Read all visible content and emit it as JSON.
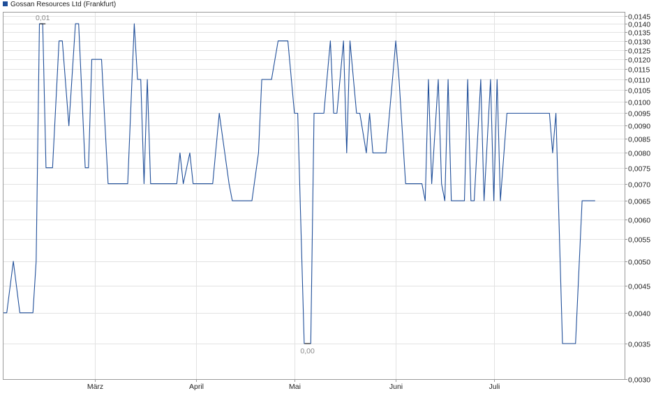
{
  "chart_data": {
    "type": "line",
    "title": "",
    "legend": {
      "label": "Gossan Resources Ltd (Frankfurt)",
      "color": "#1f4e99",
      "placement": "top-left"
    },
    "y_scale": "log",
    "ylim": [
      0.003,
      0.0147
    ],
    "y_ticks": [
      {
        "v": 0.003,
        "label": "0,0030"
      },
      {
        "v": 0.0035,
        "label": "0,0035"
      },
      {
        "v": 0.004,
        "label": "0,0040"
      },
      {
        "v": 0.0045,
        "label": "0,0045"
      },
      {
        "v": 0.005,
        "label": "0,0050"
      },
      {
        "v": 0.0055,
        "label": "0,0055"
      },
      {
        "v": 0.006,
        "label": "0,0060"
      },
      {
        "v": 0.0065,
        "label": "0,0065"
      },
      {
        "v": 0.007,
        "label": "0,0070"
      },
      {
        "v": 0.0075,
        "label": "0,0075"
      },
      {
        "v": 0.008,
        "label": "0,0080"
      },
      {
        "v": 0.0085,
        "label": "0,0085"
      },
      {
        "v": 0.009,
        "label": "0,0090"
      },
      {
        "v": 0.0095,
        "label": "0,0095"
      },
      {
        "v": 0.01,
        "label": "0,0100"
      },
      {
        "v": 0.0105,
        "label": "0,0105"
      },
      {
        "v": 0.011,
        "label": "0,0110"
      },
      {
        "v": 0.0115,
        "label": "0,0115"
      },
      {
        "v": 0.012,
        "label": "0,0120"
      },
      {
        "v": 0.0125,
        "label": "0,0125"
      },
      {
        "v": 0.013,
        "label": "0,0130"
      },
      {
        "v": 0.0135,
        "label": "0,0135"
      },
      {
        "v": 0.014,
        "label": "0,0140"
      },
      {
        "v": 0.0145,
        "label": "0,0145"
      }
    ],
    "x_range": [
      "2013-02-01",
      "2013-08-10"
    ],
    "x_ticks": [
      {
        "date": "2013-03-01",
        "label": "März"
      },
      {
        "date": "2013-04-01",
        "label": "April"
      },
      {
        "date": "2013-05-01",
        "label": "Mai"
      },
      {
        "date": "2013-06-01",
        "label": "Juni"
      },
      {
        "date": "2013-07-01",
        "label": "Juli"
      }
    ],
    "grid": true,
    "series": [
      {
        "name": "Gossan Resources Ltd (Frankfurt)",
        "color": "#1f4e99",
        "points": [
          [
            "2013-02-01",
            0.004
          ],
          [
            "2013-02-02",
            0.004
          ],
          [
            "2013-02-04",
            0.005
          ],
          [
            "2013-02-06",
            0.004
          ],
          [
            "2013-02-10",
            0.004
          ],
          [
            "2013-02-11",
            0.005
          ],
          [
            "2013-02-12",
            0.014
          ],
          [
            "2013-02-13",
            0.014
          ],
          [
            "2013-02-14",
            0.0075
          ],
          [
            "2013-02-16",
            0.0075
          ],
          [
            "2013-02-18",
            0.013
          ],
          [
            "2013-02-19",
            0.013
          ],
          [
            "2013-02-21",
            0.009
          ],
          [
            "2013-02-23",
            0.014
          ],
          [
            "2013-02-24",
            0.014
          ],
          [
            "2013-02-26",
            0.0075
          ],
          [
            "2013-02-27",
            0.0075
          ],
          [
            "2013-02-28",
            0.012
          ],
          [
            "2013-03-01",
            0.012
          ],
          [
            "2013-03-02",
            0.012
          ],
          [
            "2013-03-03",
            0.012
          ],
          [
            "2013-03-05",
            0.007
          ],
          [
            "2013-03-11",
            0.007
          ],
          [
            "2013-03-13",
            0.014
          ],
          [
            "2013-03-14",
            0.011
          ],
          [
            "2013-03-15",
            0.011
          ],
          [
            "2013-03-16",
            0.007
          ],
          [
            "2013-03-17",
            0.011
          ],
          [
            "2013-03-18",
            0.007
          ],
          [
            "2013-03-26",
            0.007
          ],
          [
            "2013-03-27",
            0.008
          ],
          [
            "2013-03-28",
            0.007
          ],
          [
            "2013-03-30",
            0.008
          ],
          [
            "2013-03-31",
            0.007
          ],
          [
            "2013-04-06",
            0.007
          ],
          [
            "2013-04-08",
            0.0095
          ],
          [
            "2013-04-11",
            0.007
          ],
          [
            "2013-04-12",
            0.0065
          ],
          [
            "2013-04-18",
            0.0065
          ],
          [
            "2013-04-20",
            0.008
          ],
          [
            "2013-04-21",
            0.011
          ],
          [
            "2013-04-24",
            0.011
          ],
          [
            "2013-04-26",
            0.013
          ],
          [
            "2013-04-29",
            0.013
          ],
          [
            "2013-05-01",
            0.0095
          ],
          [
            "2013-05-02",
            0.0095
          ],
          [
            "2013-05-04",
            0.0035
          ],
          [
            "2013-05-06",
            0.0035
          ],
          [
            "2013-05-07",
            0.0095
          ],
          [
            "2013-05-10",
            0.0095
          ],
          [
            "2013-05-12",
            0.013
          ],
          [
            "2013-05-13",
            0.0095
          ],
          [
            "2013-05-14",
            0.0095
          ],
          [
            "2013-05-16",
            0.013
          ],
          [
            "2013-05-17",
            0.008
          ],
          [
            "2013-05-18",
            0.013
          ],
          [
            "2013-05-20",
            0.0095
          ],
          [
            "2013-05-21",
            0.0095
          ],
          [
            "2013-05-23",
            0.008
          ],
          [
            "2013-05-24",
            0.0095
          ],
          [
            "2013-05-25",
            0.008
          ],
          [
            "2013-05-29",
            0.008
          ],
          [
            "2013-05-31",
            0.011
          ],
          [
            "2013-06-01",
            0.013
          ],
          [
            "2013-06-02",
            0.011
          ],
          [
            "2013-06-04",
            0.007
          ],
          [
            "2013-06-09",
            0.007
          ],
          [
            "2013-06-10",
            0.0065
          ],
          [
            "2013-06-11",
            0.011
          ],
          [
            "2013-06-12",
            0.007
          ],
          [
            "2013-06-14",
            0.011
          ],
          [
            "2013-06-15",
            0.007
          ],
          [
            "2013-06-16",
            0.0065
          ],
          [
            "2013-06-17",
            0.011
          ],
          [
            "2013-06-18",
            0.0065
          ],
          [
            "2013-06-21",
            0.0065
          ],
          [
            "2013-06-22",
            0.0065
          ],
          [
            "2013-06-23",
            0.011
          ],
          [
            "2013-06-24",
            0.0065
          ],
          [
            "2013-06-25",
            0.0065
          ],
          [
            "2013-06-27",
            0.011
          ],
          [
            "2013-06-28",
            0.0065
          ],
          [
            "2013-06-30",
            0.011
          ],
          [
            "2013-07-01",
            0.0065
          ],
          [
            "2013-07-02",
            0.011
          ],
          [
            "2013-07-03",
            0.0065
          ],
          [
            "2013-07-05",
            0.0095
          ],
          [
            "2013-07-14",
            0.0095
          ],
          [
            "2013-07-18",
            0.0095
          ],
          [
            "2013-07-19",
            0.008
          ],
          [
            "2013-07-20",
            0.0095
          ],
          [
            "2013-07-22",
            0.0035
          ],
          [
            "2013-07-25",
            0.0035
          ],
          [
            "2013-07-26",
            0.0035
          ],
          [
            "2013-07-28",
            0.0065
          ],
          [
            "2013-08-01",
            0.0065
          ]
        ]
      }
    ],
    "annotations": [
      {
        "date": "2013-02-13",
        "value": 0.014,
        "label": "0,01",
        "kind": "high"
      },
      {
        "date": "2013-05-05",
        "value": 0.0035,
        "label": "0,00",
        "kind": "low"
      }
    ]
  }
}
